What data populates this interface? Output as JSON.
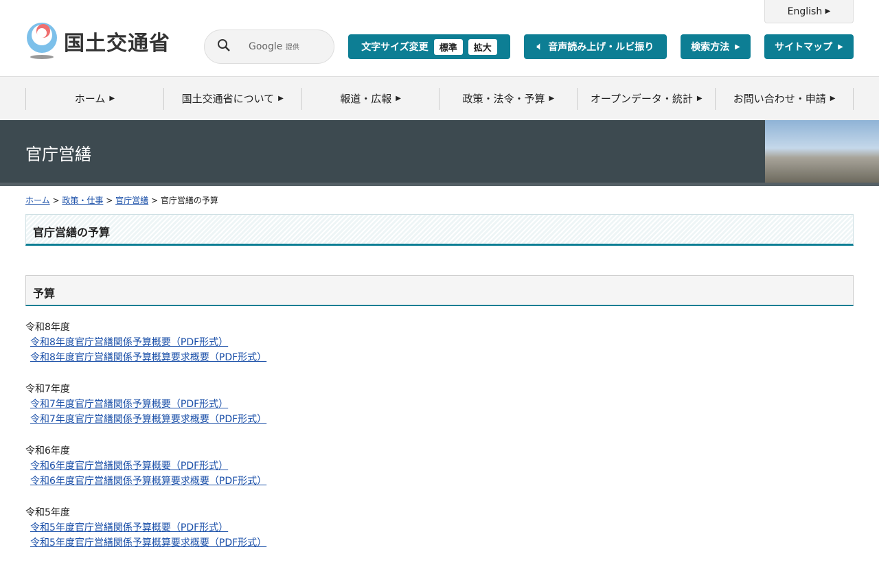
{
  "header": {
    "logo_text": "国土交通省",
    "search_provider": "Google",
    "search_provided": "提供",
    "english": "English",
    "font_size_label": "文字サイズ変更",
    "font_standard": "標準",
    "font_large": "拡大",
    "read_aloud": "音声読み上げ・ルビ振り",
    "search_method": "検索方法",
    "sitemap": "サイトマップ"
  },
  "nav": [
    "ホーム",
    "国土交通省について",
    "報道・広報",
    "政策・法令・予算",
    "オープンデータ・統計",
    "お問い合わせ・申請"
  ],
  "banner_title": "官庁営繕",
  "breadcrumb": {
    "items": [
      "ホーム",
      "政策・仕事",
      "官庁営繕"
    ],
    "current": "官庁営繕の予算",
    "sep": ">"
  },
  "page_title": "官庁営繕の予算",
  "section_title": "予算",
  "years": [
    {
      "label": "令和8年度",
      "links": [
        "令和8年度官庁営繕関係予算概要（PDF形式）",
        "令和8年度官庁営繕関係予算概算要求概要（PDF形式）"
      ]
    },
    {
      "label": "令和7年度",
      "links": [
        "令和7年度官庁営繕関係予算概要（PDF形式）",
        "令和7年度官庁営繕関係予算概算要求概要（PDF形式）"
      ]
    },
    {
      "label": "令和6年度",
      "links": [
        "令和6年度官庁営繕関係予算概要（PDF形式）",
        "令和6年度官庁営繕関係予算概算要求概要（PDF形式）"
      ]
    },
    {
      "label": "令和5年度",
      "links": [
        "令和5年度官庁営繕関係予算概要（PDF形式）",
        "令和5年度官庁営繕関係予算概算要求概要（PDF形式）"
      ]
    }
  ]
}
